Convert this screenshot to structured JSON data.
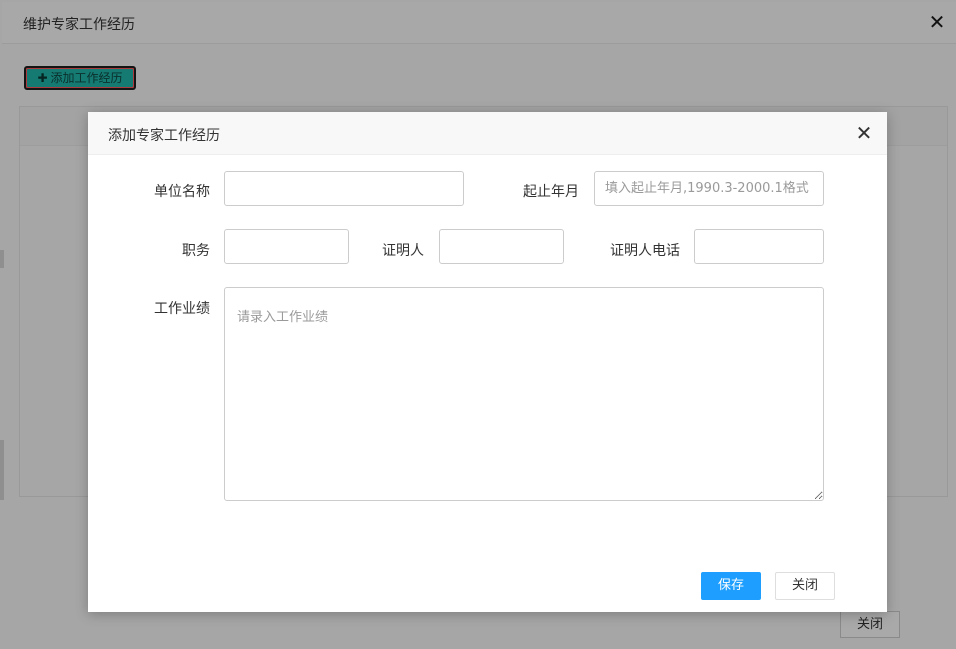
{
  "outer_window": {
    "title": "维护专家工作经历",
    "close_glyph": "✕",
    "add_button_plus": "✚",
    "add_button_label": "添加工作经历",
    "close_button_label": "关闭"
  },
  "dialog": {
    "title": "添加专家工作经历",
    "close_glyph": "✕",
    "fields": {
      "company_label": "单位名称",
      "company_value": "",
      "period_label": "起止年月",
      "period_value": "",
      "period_placeholder": "填入起止年月,1990.3-2000.1格式",
      "position_label": "职务",
      "position_value": "",
      "witness_label": "证明人",
      "witness_value": "",
      "witness_phone_label": "证明人电话",
      "witness_phone_value": "",
      "achievements_label": "工作业绩",
      "achievements_value": "",
      "achievements_placeholder": "请录入工作业绩"
    },
    "save_label": "保存",
    "close_label": "关闭"
  },
  "colors": {
    "overlay_gray": "#a6a6a6",
    "primary_blue": "#1e9fff",
    "add_button_teal": "#147a72",
    "add_button_red_outline": "#a93a3e"
  },
  "icons": {
    "outer_close": "close-icon",
    "dialog_close": "close-icon",
    "add": "plus-icon"
  }
}
